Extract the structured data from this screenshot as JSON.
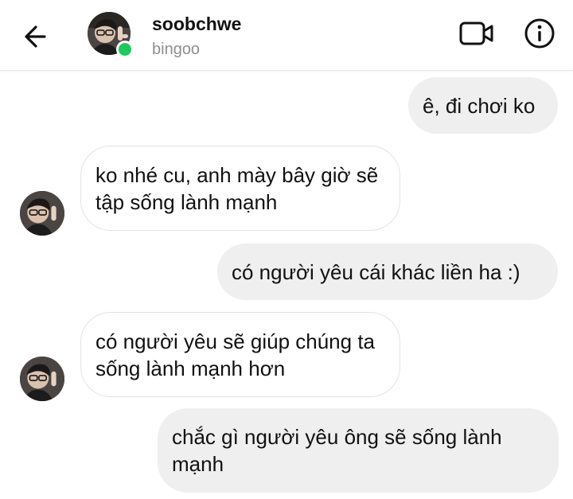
{
  "header": {
    "username": "soobchwe",
    "status": "bingoo"
  },
  "icons": {
    "back": "arrow-left-icon",
    "video": "video-call-icon",
    "info": "info-icon"
  },
  "colors": {
    "online": "#22c55e",
    "outgoing_bubble": "#efefef",
    "incoming_border": "#e3e3e3",
    "status_text": "#8e8e8e"
  },
  "messages": [
    {
      "direction": "outgoing",
      "text": "ê, đi chơi ko"
    },
    {
      "direction": "incoming",
      "text": "ko nhé cu, anh mày bây giờ sẽ tập sống lành mạnh"
    },
    {
      "direction": "outgoing",
      "text": "có người yêu cái khác liền ha :)"
    },
    {
      "direction": "incoming",
      "text": "có người yêu sẽ giúp chúng ta sống lành mạnh hơn"
    },
    {
      "direction": "outgoing",
      "text": "chắc gì người yêu ông sẽ sống lành mạnh"
    }
  ]
}
